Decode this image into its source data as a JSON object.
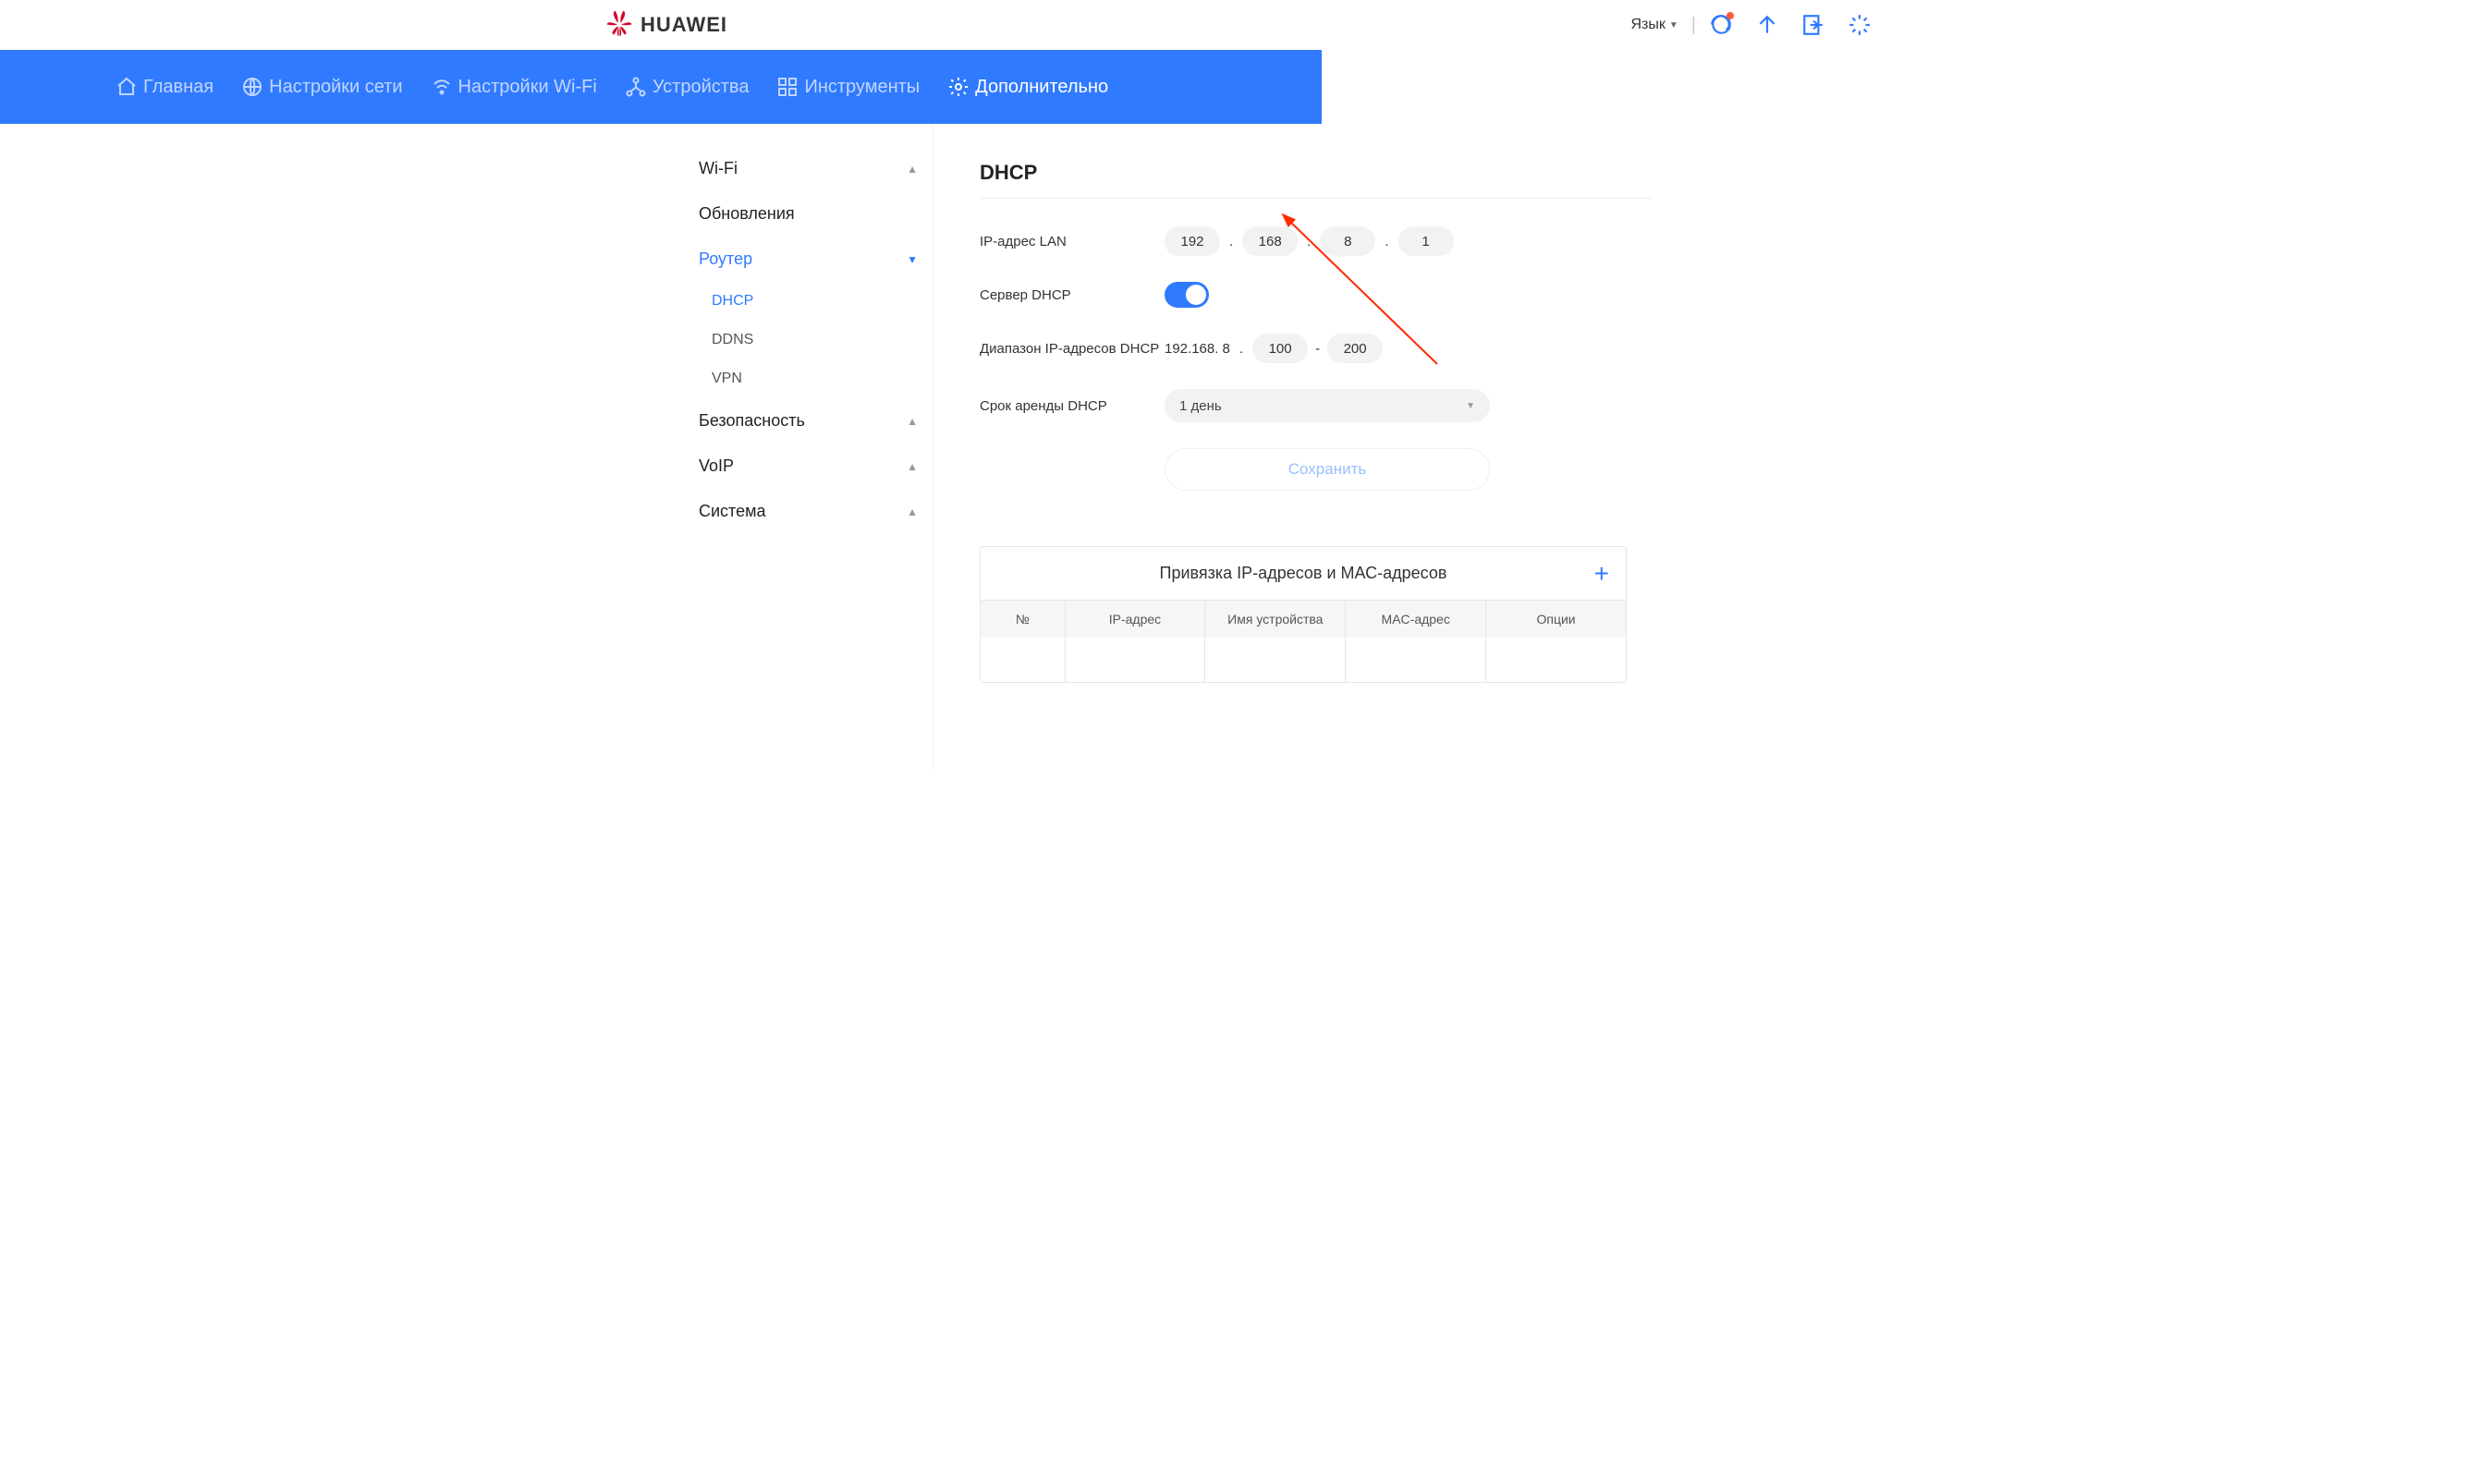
{
  "header": {
    "brand": "HUAWEI",
    "language_label": "Язык"
  },
  "topnav": {
    "items": [
      {
        "label": "Главная"
      },
      {
        "label": "Настройки сети"
      },
      {
        "label": "Настройки Wi-Fi"
      },
      {
        "label": "Устройства"
      },
      {
        "label": "Инструменты"
      },
      {
        "label": "Дополнительно"
      }
    ]
  },
  "sidebar": {
    "items": [
      {
        "label": "Wi-Fi",
        "expanded": false
      },
      {
        "label": "Обновления",
        "leaf": true
      },
      {
        "label": "Роутер",
        "expanded": true,
        "children": [
          {
            "label": "DHCP",
            "active": true
          },
          {
            "label": "DDNS"
          },
          {
            "label": "VPN"
          }
        ]
      },
      {
        "label": "Безопасность",
        "expanded": false
      },
      {
        "label": "VoIP",
        "expanded": false
      },
      {
        "label": "Система",
        "expanded": false
      }
    ]
  },
  "page": {
    "title": "DHCP",
    "lan_ip_label": "IP-адрес LAN",
    "lan_ip": {
      "o1": "192",
      "o2": "168",
      "o3": "8",
      "o4": "1"
    },
    "dhcp_server_label": "Сервер DHCP",
    "dhcp_server_on": true,
    "range_label": "Диапазон IP-адресов DHCP",
    "range_prefix": "192.168. 8",
    "range_start": "100",
    "range_dash": "-",
    "range_end": "200",
    "lease_label": "Срок аренды DHCP",
    "lease_value": "1 день",
    "save_button": "Сохранить"
  },
  "bind": {
    "title": "Привязка IP-адресов и МАС-адресов",
    "columns": [
      "№",
      "IP-адрес",
      "Имя устройства",
      "MAC-адрес",
      "Опции"
    ]
  }
}
